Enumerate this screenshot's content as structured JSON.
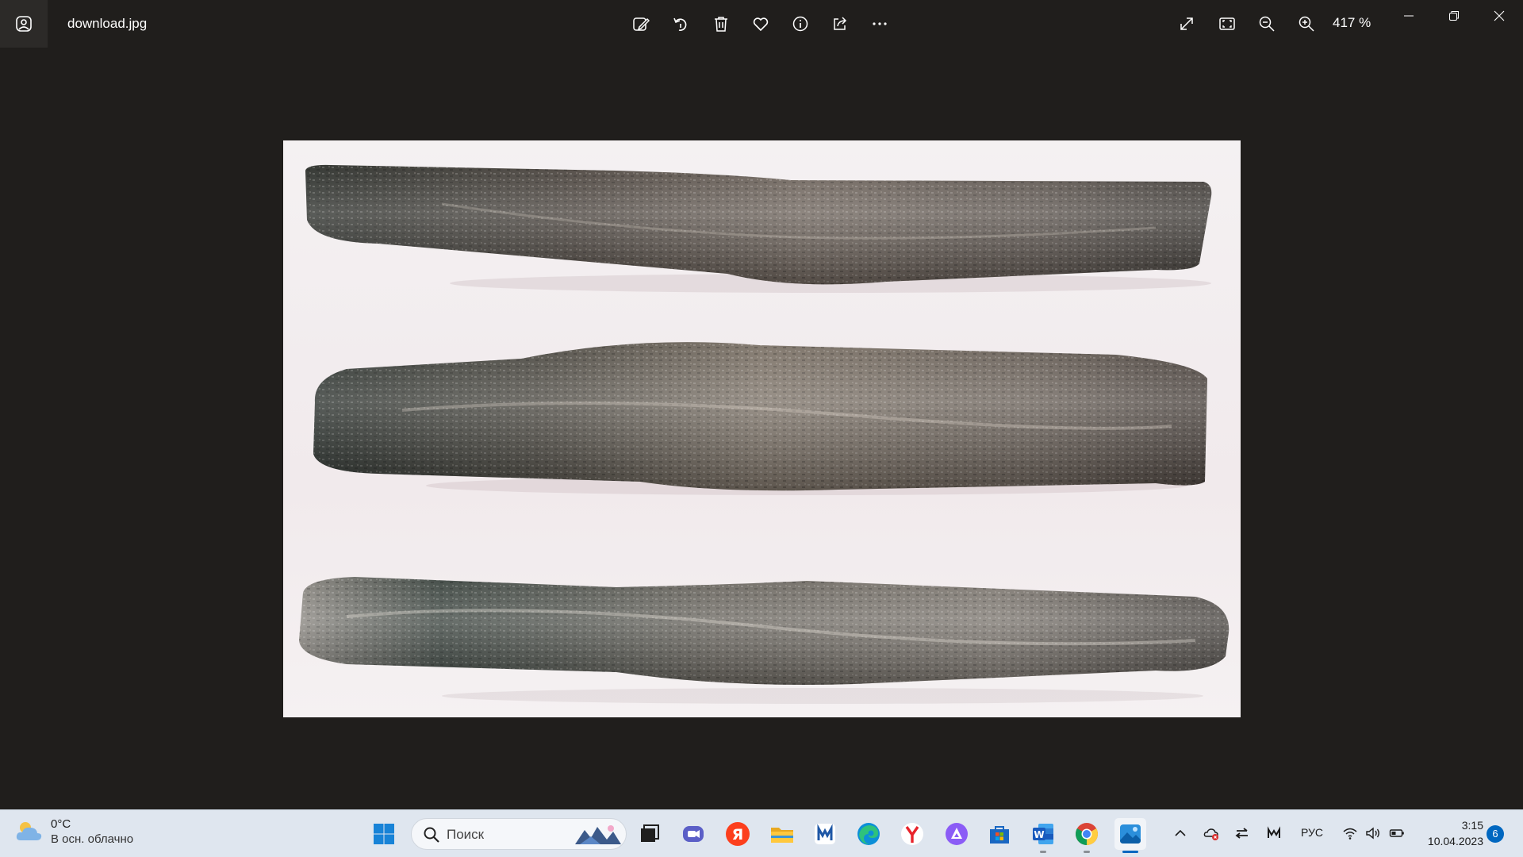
{
  "window": {
    "file_name": "download.jpg",
    "zoom_level": "417 %",
    "toolbar": {
      "edit_icon": "edit-image-icon",
      "rotate_icon": "rotate-icon",
      "delete_icon": "trash-icon",
      "favorite_icon": "heart-icon",
      "info_icon": "info-icon",
      "share_icon": "share-icon",
      "more_icon": "more-icon",
      "fullscreen_icon": "fullscreen-icon",
      "fit_icon": "fit-to-window-icon",
      "zoom_out_icon": "zoom-out-icon",
      "zoom_in_icon": "zoom-in-icon"
    },
    "controls": [
      "minimize-icon",
      "restore-icon",
      "close-icon"
    ]
  },
  "photo": {
    "subject_icon": "metal-bars-photo",
    "background_color": "#f2eef0"
  },
  "taskbar": {
    "weather": {
      "temperature": "0°C",
      "description": "В осн. облачно",
      "icon": "partly-cloudy-icon"
    },
    "search": {
      "placeholder": "Поиск"
    },
    "apps": [
      "windows-start-icon",
      "task-view-icon",
      "teams-chat-icon",
      "yandex-icon",
      "file-explorer-icon",
      "mail-m-icon",
      "edge-icon",
      "yandex-browser-icon",
      "alice-icon",
      "store-icon",
      "word-icon",
      "chrome-icon",
      "photos-icon"
    ],
    "tray": {
      "language": "РУС",
      "time": "3:15",
      "date": "10.04.2023",
      "notification_count": "6"
    }
  }
}
